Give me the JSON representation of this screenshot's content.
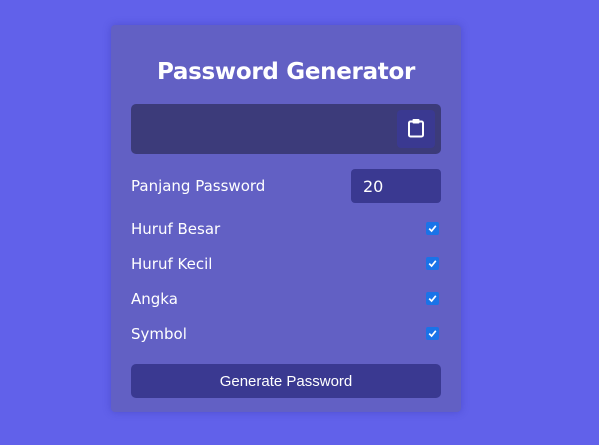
{
  "colors": {
    "background": "#6161ea",
    "card": "#6260c4",
    "result_box": "#3c3b7a",
    "button": "#3a3991",
    "checkbox": "#1a73e8"
  },
  "card": {
    "title": "Password Generator",
    "result": {
      "value": "",
      "copy_icon": "clipboard-icon"
    },
    "length": {
      "label": "Panjang Password",
      "value": "20"
    },
    "options": [
      {
        "label": "Huruf Besar",
        "checked": true
      },
      {
        "label": "Huruf Kecil",
        "checked": true
      },
      {
        "label": "Angka",
        "checked": true
      },
      {
        "label": "Symbol",
        "checked": true
      }
    ],
    "generate_label": "Generate Password"
  }
}
